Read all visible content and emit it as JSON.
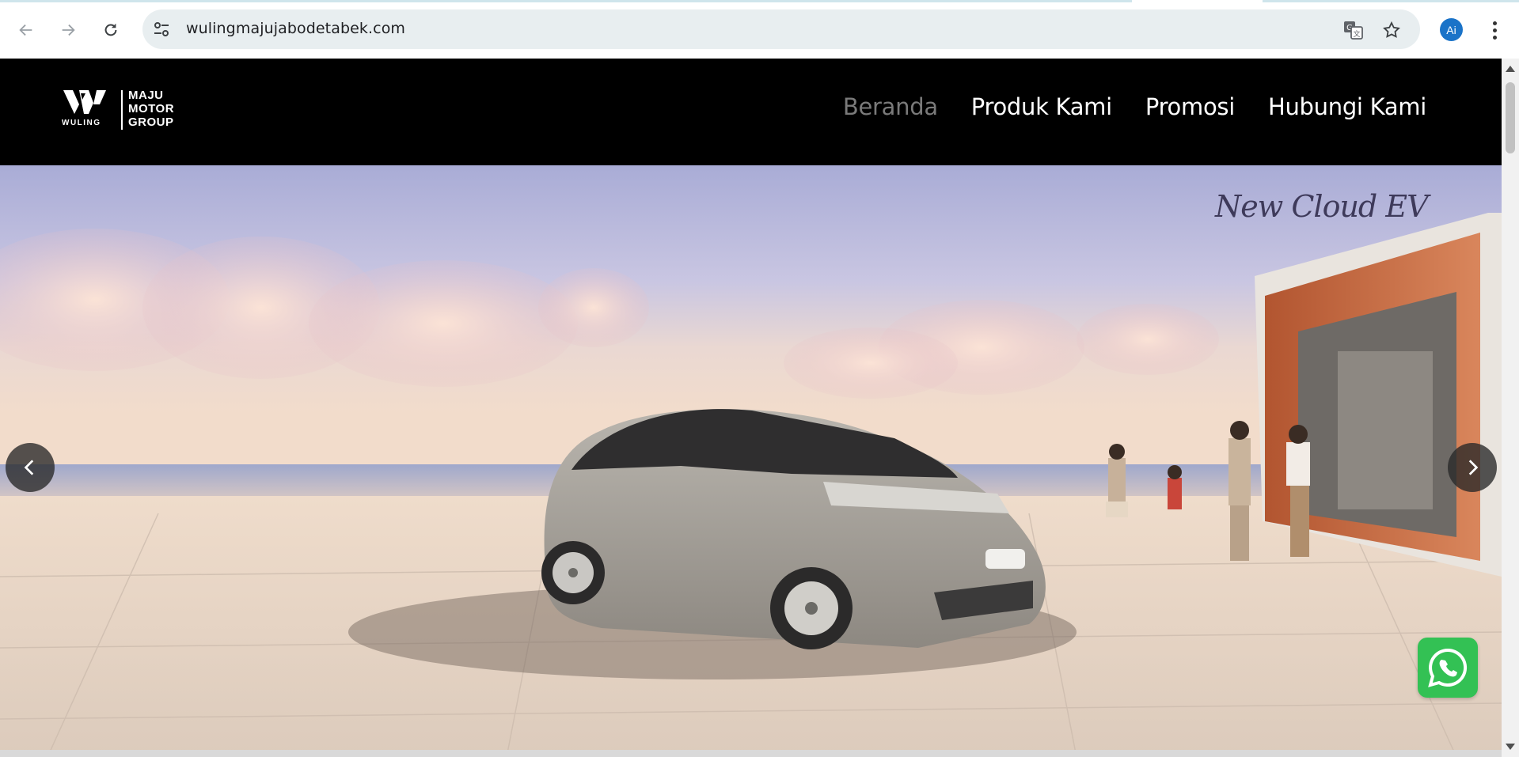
{
  "browser": {
    "url": "wulingmajujabodetabek.com",
    "avatar_initials": "Ai",
    "icons": [
      "back-arrow-icon",
      "forward-arrow-icon",
      "reload-icon",
      "site-settings-icon",
      "translate-icon",
      "star-icon",
      "kebab-menu-icon"
    ]
  },
  "site": {
    "logo": {
      "brand": "WULING",
      "group_lines": [
        "MAJU",
        "MOTOR",
        "GROUP"
      ]
    },
    "nav": [
      {
        "label": "Beranda",
        "active": true
      },
      {
        "label": "Produk Kami",
        "active": false
      },
      {
        "label": "Promosi",
        "active": false
      },
      {
        "label": "Hubungi Kami",
        "active": false
      }
    ],
    "hero": {
      "tagline": "New Cloud EV",
      "badge_text": "New Cloud EV"
    },
    "colors": {
      "header_bg": "#000000",
      "nav_active": "#7a7a7a",
      "whatsapp": "#33c154"
    }
  }
}
